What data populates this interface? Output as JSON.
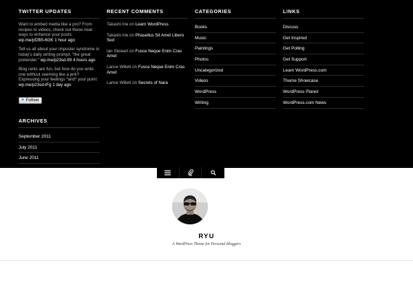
{
  "twitter": {
    "title": "Twitter Updates",
    "tweets": [
      {
        "text": "Want to embed media like a pro? From recipes to videos, check out these neat ways to enhance your posts:",
        "link": "wp.me/pf2B5-6GK",
        "time": "1 hour ago"
      },
      {
        "text": "Tell us all about your imposter syndrome in today's daily writing prompt, \"the great pretender.\"",
        "link": "wp.me/p23sd-lI9",
        "time": "4 hours ago"
      },
      {
        "text": "Blog rants are fun, but how do you write one without seeming like a jerk? Expressing your feelings *and* your point:",
        "link": "wp.me/p23sd-lFg",
        "time": "1 day ago"
      }
    ],
    "follow_label": "Follow"
  },
  "archives": {
    "title": "Archives",
    "items": [
      "September 2011",
      "July 2011",
      "June 2011"
    ]
  },
  "recent_comments": {
    "title": "Recent Comments",
    "connector": "on",
    "items": [
      {
        "author": "Takashi Irie",
        "post": "Learn WordPress"
      },
      {
        "author": "Takashi Irie",
        "post": "Phasellus Sit Amet Libero Sed"
      },
      {
        "author": "Ian Stewart",
        "post": "Fusce Neque Enim Cras Amet"
      },
      {
        "author": "Lance Willett",
        "post": "Fusce Neque Enim Cras Amet"
      },
      {
        "author": "Lance Willett",
        "post": "Secrets of Nara"
      }
    ]
  },
  "categories": {
    "title": "Categories",
    "items": [
      "Books",
      "Music",
      "Paintings",
      "Photos",
      "Uncategorized",
      "Videos",
      "WordPress",
      "Writing"
    ]
  },
  "links": {
    "title": "Links",
    "items": [
      "Discuss",
      "Get Inspired",
      "Get Polling",
      "Get Support",
      "Learn WordPress.com",
      "Theme Showcase",
      "WordPress Planet",
      "WordPress.com News"
    ]
  },
  "menu_bar": {
    "icons": [
      "menu-icon",
      "paperclip-icon",
      "search-icon"
    ]
  },
  "site": {
    "title": "RYU",
    "tagline": "A WordPress Theme for Personal Bloggers"
  },
  "colors": {
    "footer_bg": "#000000",
    "page_bg": "#ffffff",
    "muted_text": "#bfbfbf"
  }
}
